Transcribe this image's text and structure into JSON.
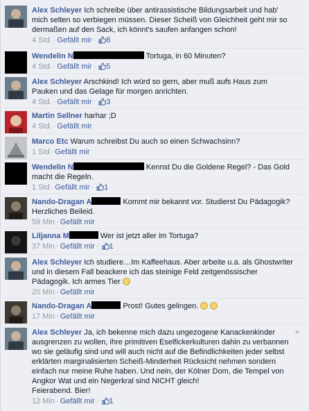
{
  "like_label": "Gefällt mir",
  "close_glyph": "×",
  "comments": [
    {
      "author": "Alex Schleyer",
      "text": "Ich schreibe über antirassistische Bildungsarbeit und hab' mich selten so verbiegen müssen. Dieser Scheiß von Gleichheit geht mir so dermaßen auf den Sack, ich könnt's saufen anfangen schon!",
      "time": "4 Std.",
      "likes": "8"
    },
    {
      "author": "Wendelin N",
      "text": "Tortuga, in 60 Minuten?",
      "time": "4 Std.",
      "likes": "5"
    },
    {
      "author": "Alex Schleyer",
      "text": "Arschkind! Ich würd so gern, aber muß aufs Haus zum Pauken und das Gelage für morgen anrichten.",
      "time": "4 Std.",
      "likes": "3"
    },
    {
      "author": "Martin Sellner",
      "text": "harhar ;D",
      "time": "4 Std."
    },
    {
      "author": "Marco Etc",
      "text": "Warum schreibst Du auch so einen Schwachsinn?",
      "time": "1 Std"
    },
    {
      "author": "Wendelin N",
      "text": "Kennst Du die Goldene Regel? - Das Gold macht die Regeln.",
      "time": "1 Std",
      "likes": "1"
    },
    {
      "author": "Nando-Dragan A",
      "text": "Kommt mir bekannt vor. Studierst Du Pädagogik? Herzliches Beileid.",
      "time": "59 Min"
    },
    {
      "author": "Liljanna M",
      "text": "Wer ist jetzt aller im Tortuga?",
      "time": "37 Min",
      "likes": "1"
    },
    {
      "author": "Alex Schleyer",
      "text": "Ich studiere…Im Kaffeehaus. Aber arbeite u.a. als Ghostwriter und in diesem Fall beackere ich das steinige Feld zeitgenössischer Pädagogik. Ich armes Tier",
      "time": "20 Min"
    },
    {
      "author": "Nando-Dragan A",
      "text": "Prost! Gutes gelingen.",
      "time": "17 Min"
    },
    {
      "author": "Alex Schleyer",
      "text": "Ja, ich bekenne mich dazu ungezogene Kanackenkinder ausgrenzen zu wollen, ihre primitiven Eselfickerkulturen dahin zu verbannen wo sie geläufig sind und will auch nicht auf die Befindlichkeiten jeder selbst erklärten marginalisierten Scheiß-Minderheit Rücksicht nehmen sondern einfach nur meine Ruhe haben. Und nein, der Kölner Dom, die Tempel von Angkor Wat und ein Negerkral sind NICHT gleich!",
      "text2": "Feierabend. Bier!",
      "time": "12 Min",
      "likes": "1"
    }
  ]
}
